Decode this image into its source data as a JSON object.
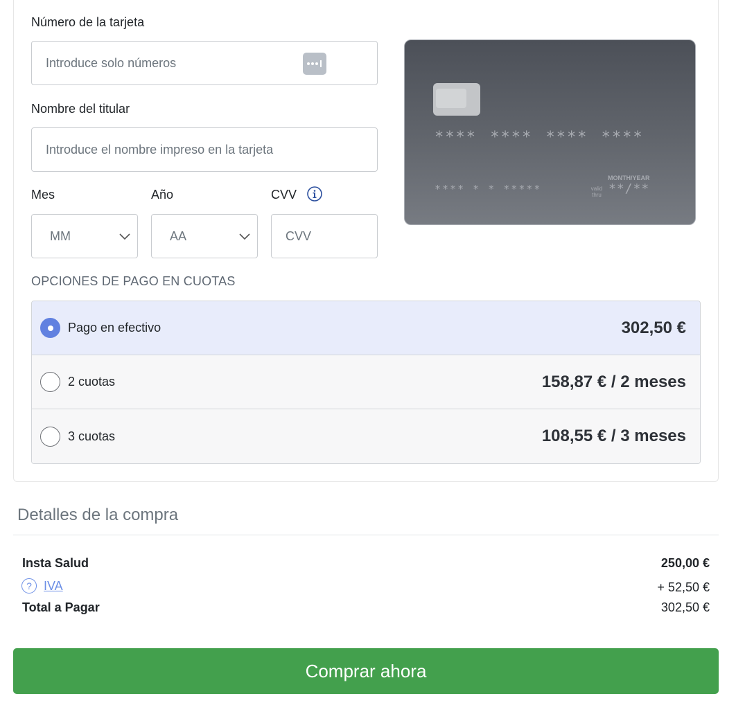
{
  "form": {
    "card_number_label": "Número de la tarjeta",
    "card_number_placeholder": "Introduce solo números",
    "holder_label": "Nombre del titular",
    "holder_placeholder": "Introduce el nombre impreso en la tarjeta",
    "month_label": "Mes",
    "month_value": "MM",
    "year_label": "Año",
    "year_value": "AA",
    "cvv_label": "CVV",
    "cvv_placeholder": "CVV"
  },
  "card_preview": {
    "number": "**** **** **** ****",
    "name": "**** * * *****",
    "valid_thru": "valid thru",
    "month_year_label": "MONTH/YEAR",
    "expiry": "**/**"
  },
  "installments": {
    "title": "OPCIONES DE PAGO EN CUOTAS",
    "options": [
      {
        "label": "Pago en efectivo",
        "amount": "302,50 €",
        "selected": true
      },
      {
        "label": "2 cuotas",
        "amount": "158,87 € / 2 meses",
        "selected": false
      },
      {
        "label": "3 cuotas",
        "amount": "108,55 € / 3 meses",
        "selected": false
      }
    ]
  },
  "details": {
    "title": "Detalles de la compra",
    "product_name": "Insta Salud",
    "product_price": "250,00 €",
    "tax_help_icon": "?",
    "tax_label": "IVA",
    "tax_amount": "+ 52,50 €",
    "total_label": "Total a Pagar",
    "total_amount": "302,50 €"
  },
  "actions": {
    "buy_label": "Comprar ahora"
  },
  "colors": {
    "accent": "#6181e0",
    "buy_button": "#43a04d",
    "selected_option_bg": "#e8ecfb",
    "link": "#6c8fe6"
  },
  "icons": [
    "card-type-icon",
    "chevron-down-icon",
    "info-icon",
    "help-icon"
  ]
}
